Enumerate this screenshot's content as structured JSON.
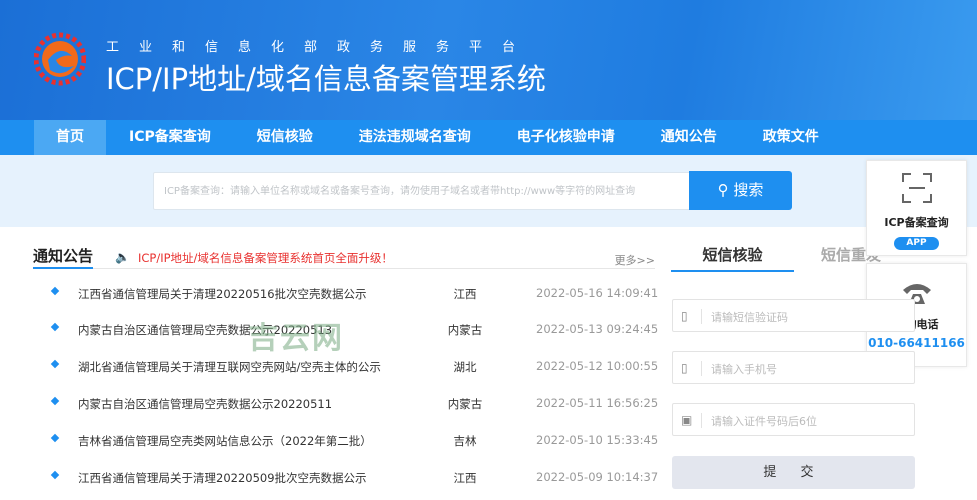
{
  "header": {
    "subtitle": "工业和信息化部政务服务平台",
    "title": "ICP/IP地址/域名信息备案管理系统",
    "logo_icon": "gear-e-logo"
  },
  "nav": {
    "items": [
      {
        "label": "首页",
        "active": true
      },
      {
        "label": "ICP备案查询"
      },
      {
        "label": "短信核验"
      },
      {
        "label": "违法违规域名查询"
      },
      {
        "label": "电子化核验申请"
      },
      {
        "label": "通知公告"
      },
      {
        "label": "政策文件"
      }
    ]
  },
  "search": {
    "placeholder": "ICP备案查询：请输入单位名称或域名或备案号查询，请勿使用子域名或者带http://www等字符的网址查询",
    "button_label": "搜索",
    "button_icon": "search-icon"
  },
  "notices": {
    "title": "通知公告",
    "marquee": "ICP/IP地址/域名信息备案管理系统首页全面升级！",
    "more": "更多>>",
    "items": [
      {
        "title": "江西省通信管理局关于清理20220516批次空壳数据公示",
        "province": "江西",
        "date": "2022-05-16 14:09:41"
      },
      {
        "title": "内蒙古自治区通信管理局空壳数据公示20220513",
        "province": "内蒙古",
        "date": "2022-05-13 09:24:45"
      },
      {
        "title": "湖北省通信管理局关于清理互联网空壳网站/空壳主体的公示",
        "province": "湖北",
        "date": "2022-05-12 10:00:55"
      },
      {
        "title": "内蒙古自治区通信管理局空壳数据公示20220511",
        "province": "内蒙古",
        "date": "2022-05-11 16:56:25"
      },
      {
        "title": "吉林省通信管理局空壳类网站信息公示（2022年第二批）",
        "province": "吉林",
        "date": "2022-05-10 15:33:45"
      },
      {
        "title": "江西省通信管理局关于清理20220509批次空壳数据公示",
        "province": "江西",
        "date": "2022-05-09 10:14:37"
      }
    ]
  },
  "watermark": "吉云网",
  "sms": {
    "tabs": [
      "短信核验",
      "短信重发"
    ],
    "fields": [
      {
        "placeholder": "请输短信验证码",
        "icon": "sms-phone-icon"
      },
      {
        "placeholder": "请输入手机号",
        "icon": "mobile-icon"
      },
      {
        "placeholder": "请输入证件号码后6位",
        "icon": "id-card-icon"
      }
    ],
    "submit": "提 交"
  },
  "side": {
    "app_label": "ICP备案查询",
    "app_badge": "APP",
    "phone_label": "咨询电话",
    "phone_number": "010-66411166"
  },
  "colors": {
    "brand": "#1e8ff0",
    "alert": "#e8312f"
  }
}
